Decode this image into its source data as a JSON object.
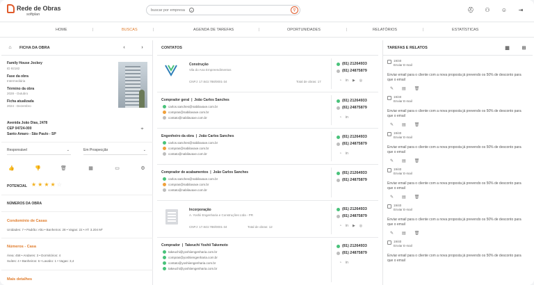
{
  "app": {
    "logo_text": "Rede de Obras",
    "logo_sub": "softplan",
    "search_placeholder": "buscar por empresa"
  },
  "nav": {
    "items": [
      "HOME",
      "BUSCAS",
      "AGENDA DE TAREFAS",
      "OPORTUNIDADES",
      "RELATÓRIOS",
      "ESTATÍSTICAS"
    ],
    "active": "BUSCAS"
  },
  "ficha": {
    "title": "FICHA DA OBRA",
    "name": "Family House Jockey",
    "id": "ID 92182",
    "fase_label": "Fase da obra",
    "fase_value": "Intermediária",
    "termino_label": "Término da obra",
    "termino_value": "2028 - Outubro",
    "atualizada_label": "Ficha atualizada",
    "atualizada_value": "2024 - Dezembro",
    "address1": "Avenida João Dias, 2478",
    "address2": "CEP 04724-000",
    "address3": "Santo Amaro - São Paulo - SP",
    "responsavel": "Responsável",
    "prospeccao": "Em Prospecção",
    "potencial_label": "POTENCIAL",
    "potencial_stars": 4,
    "numeros_title": "NÚMEROS DA OBRA",
    "condominio_title": "Condomínio de Casas",
    "condominio_stats": "Unidades: 7   •   Padrão: Alto   •   Banheiros: 28   •   Vagas: 22   •   AT: 3.204 M²",
    "numeros_casa_title": "Números - Casa",
    "casa_stats1": "Área: 458   •   Andares: 3   •   Dormitórios: 4",
    "casa_stats2": "Suítes: 4   •   Banheiros: 6   •   Lavabo: 1   •   Vagas: 3,4",
    "mais_detalhes": "Mais detalhes"
  },
  "contatos": {
    "title": "CONTATOS",
    "cards": [
      {
        "type": "company",
        "role": "Construção",
        "company": "Vila do Ana Empreendimentos",
        "cnpj": "CNPJ: 17.843.788/0001-34",
        "total": "Total de obras: 17",
        "phones": [
          "(81) 21264933",
          "(81) 24875879"
        ]
      },
      {
        "type": "person",
        "role": "Comprador geral",
        "name": "João Carlos Sanches",
        "emails": [
          "carlos.sanches@nabilavaxe.com.br",
          "compras@nabilavaxe.com.br",
          "contato@nabilavaxe.com.br"
        ],
        "phones": [
          "(81) 21264933",
          "(81) 24875879"
        ]
      },
      {
        "type": "person",
        "role": "Engenheiro da obra",
        "name": "João Carlos Sanches",
        "emails": [
          "carlos.sanches@nabilavaxe.com.br",
          "compras@nabilavaxe.com.br",
          "contato@nabilavaxe.com.br"
        ],
        "phones": [
          "(81) 21264933",
          "(81) 24875879"
        ]
      },
      {
        "type": "person",
        "role": "Comprador de acabamentos",
        "name": "João Carlos Sanches",
        "emails": [
          "carlos.sanches@nabilavaxe.com.br",
          "compras@nabilavaxe.com.br",
          "contato@nabilavaxe.com.br"
        ],
        "phones": [
          "(81) 21264933",
          "(81) 24875879"
        ]
      },
      {
        "type": "company",
        "role": "Incorporação",
        "company": "A. Yoshii Engenharia e Construções Ltda - PR",
        "cnpj": "CNPJ: 17.843.788/0001-34",
        "total": "Total de obras: 12",
        "phones": [
          "(81) 21264933",
          "(81) 24875879"
        ]
      },
      {
        "type": "person",
        "role": "Comprador",
        "name": "Takeuchi Yoshii Takemoto",
        "emails": [
          "takeuchi@yoshiiengenharia.com.br",
          "compras@yoshiiengenharia.com.br",
          "contato@yoshiiengenharia.com.br",
          "takeuchi@yoshiiengenharia.com.br"
        ],
        "phones": [
          "(81) 21264933",
          "(81) 24875879"
        ]
      }
    ]
  },
  "tarefas": {
    "title": "TAREFAS E RELATOS",
    "items": [
      {
        "date": "19/40",
        "type": "Enviar E-mail",
        "desc": "Enviar email para o cliente com a nova proposta já prevendo os 50% de desconto para que o email"
      },
      {
        "date": "19/40",
        "type": "Enviar E-mail",
        "desc": "Enviar email para o cliente com a nova proposta já prevendo os 50% de desconto para que o email"
      },
      {
        "date": "19/40",
        "type": "Enviar E-mail",
        "desc": "Enviar email para o cliente com a nova proposta já prevendo os 50% de desconto para que o email"
      },
      {
        "date": "19/40",
        "type": "Enviar E-mail",
        "desc": "Enviar email para o cliente com a nova proposta já prevendo os 50% de desconto para que o email"
      },
      {
        "date": "19/40",
        "type": "Enviar E-mail",
        "desc": "Enviar email para o cliente com a nova proposta já prevendo os 50% de desconto para que o email"
      },
      {
        "date": "19/40",
        "type": "Enviar E-mail",
        "desc": "Enviar email para o cliente com a nova proposta já prevendo os 50% de desconto para que o email"
      }
    ]
  },
  "colors": {
    "accent": "#e07b2a",
    "green": "#49c27a"
  }
}
